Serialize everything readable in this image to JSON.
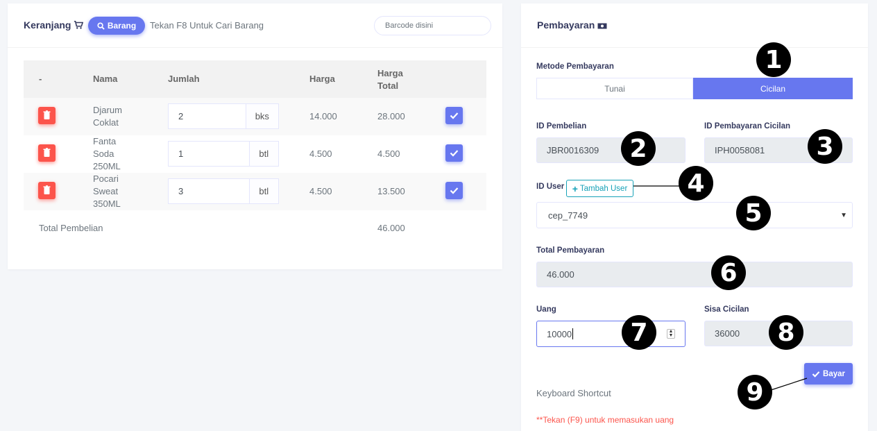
{
  "cart": {
    "title": "Keranjang",
    "barang_button": "Barang",
    "hint": "Tekan F8 Untuk Cari Barang",
    "barcode_placeholder": "Barcode disini",
    "columns": [
      "-",
      "Nama",
      "Jumlah",
      "Harga",
      "Harga Total"
    ],
    "rows": [
      {
        "nama": "Djarum Coklat",
        "jumlah": "2",
        "satuan": "bks",
        "harga": "14.000",
        "total": "28.000"
      },
      {
        "nama": "Fanta Soda 250ML",
        "jumlah": "1",
        "satuan": "btl",
        "harga": "4.500",
        "total": "4.500"
      },
      {
        "nama": "Pocari Sweat 350ML",
        "jumlah": "3",
        "satuan": "btl",
        "harga": "4.500",
        "total": "13.500"
      }
    ],
    "total_label": "Total Pembelian",
    "total_value": "46.000"
  },
  "payment": {
    "title": "Pembayaran",
    "method_label": "Metode Pembayaran",
    "methods": [
      "Tunai",
      "Cicilan"
    ],
    "selected_method": "Cicilan",
    "id_pembelian_label": "ID Pembelian",
    "id_pembelian": "JBR0016309",
    "id_cicilan_label": "ID Pembayaran Cicilan",
    "id_cicilan": "IPH0058081",
    "id_user_label": "ID User",
    "tambah_user_button": "Tambah User",
    "user_selected": "cep_7749",
    "total_label": "Total Pembayaran",
    "total_value": "46.000",
    "uang_label": "Uang",
    "uang_value": "10000",
    "sisa_label": "Sisa Cicilan",
    "sisa_value": "36000",
    "bayar_button": "Bayar",
    "shortcut_label": "Keyboard Shortcut",
    "shortcut_hint": "**Tekan (F9) untuk memasukan uang"
  },
  "markers": [
    "1",
    "2",
    "3",
    "4",
    "5",
    "6",
    "7",
    "8",
    "9"
  ],
  "colors": {
    "primary": "#6777ef",
    "danger": "#fc544b",
    "info": "#17a2b8"
  }
}
